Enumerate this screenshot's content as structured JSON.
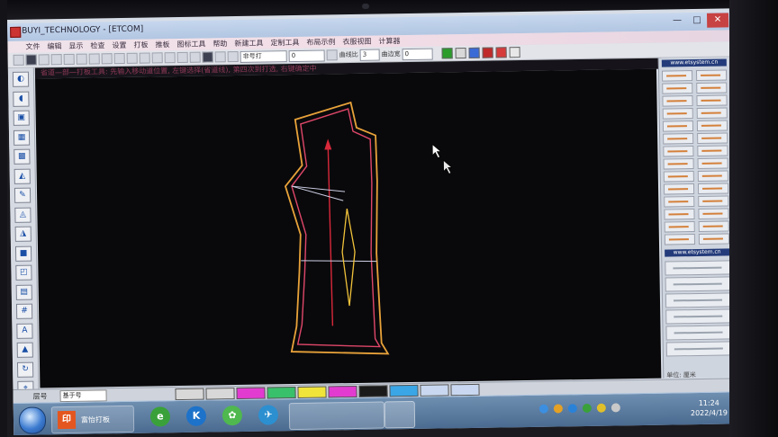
{
  "window": {
    "title": "BUYI_TECHNOLOGY - [ETCOM]",
    "controls": [
      "—",
      "□",
      "✕"
    ]
  },
  "menu": {
    "items": [
      "文件",
      "编辑",
      "显示",
      "检查",
      "设置",
      "打板",
      "推板",
      "图标工具",
      "帮助",
      "新建工具",
      "定制工具",
      "布局示例",
      "衣服视图",
      "计算器"
    ]
  },
  "toolbar": {
    "layer_select": "非号打",
    "value_field": "0",
    "label_a": "曲线比",
    "value_a": "3",
    "label_b": "曲边宽",
    "value_b": "0",
    "colors": [
      "#2a9c2a",
      "#d8d8d8",
      "#3a6ad6",
      "#c02a2a",
      "#d63a3a",
      "#e8e8e8"
    ]
  },
  "hint": {
    "text": "省道—部—打板工具: 先输入移动道位置, 左键选择(省道线), 第四次到打选, 右键确定中"
  },
  "left_tools": {
    "icons": [
      "pointer-icon",
      "arc-icon",
      "rectangle-icon",
      "grid-icon",
      "fill-icon",
      "measure-icon",
      "pen-icon",
      "angle-icon",
      "knife-icon",
      "square-icon",
      "notch-icon",
      "ruler-icon",
      "hash-icon",
      "text-icon",
      "triangle-icon",
      "rotate-icon",
      "pin-icon"
    ],
    "glyphs": [
      "◐",
      "◖",
      "▣",
      "▦",
      "▩",
      "◭",
      "✎",
      "◬",
      "◮",
      "■",
      "◰",
      "▤",
      "#",
      "A",
      "▲",
      "↻",
      "⌖"
    ]
  },
  "right_panel": {
    "banner_top": "www.etsystem.cn",
    "banner_bottom": "www.etsystem.cn",
    "unit_label": "单位: 厘米"
  },
  "bottom_strip": {
    "layer_label": "层号",
    "layer_value": "基于号",
    "swatches": [
      "#d8d8d8",
      "#d8d8d8",
      "#e23bd0",
      "#39c06a",
      "#f0e43a",
      "#e23bd0",
      "#1a1a1a",
      "#3aa6e6",
      "#c9d8f0",
      "#c9d8f0"
    ]
  },
  "taskbar": {
    "app_label": "富怡打板",
    "app_icon": "印",
    "icons": [
      "edge-icon",
      "kuaiya-icon",
      "wechat-icon",
      "feather-icon"
    ],
    "icon_glyphs": [
      "e",
      "K",
      "✿",
      "✈"
    ],
    "icon_colors": [
      "#3aa13a",
      "#1d72c9",
      "#4fb84f",
      "#2c8fd0"
    ],
    "tray_colors": [
      "#3c8fe0",
      "#e5a124",
      "#2a82d8",
      "#3aa13a",
      "#e0c02a",
      "#c9c9c9"
    ],
    "clock_time": "11:24",
    "clock_date": "2022/4/19"
  }
}
